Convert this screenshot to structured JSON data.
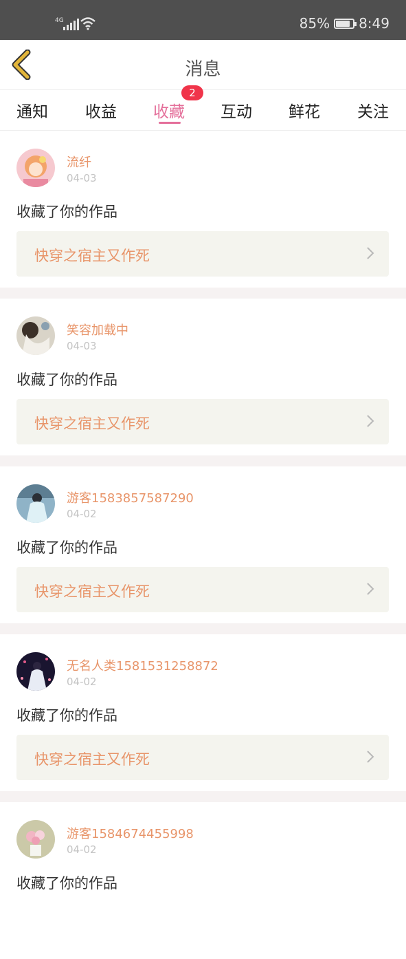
{
  "status_bar": {
    "network": "4G",
    "battery": "85%",
    "battery_level": 0.85,
    "time": "8:49"
  },
  "nav": {
    "title": "消息"
  },
  "tabs": [
    {
      "label": "通知"
    },
    {
      "label": "收益"
    },
    {
      "label": "收藏",
      "active": true,
      "badge": "2"
    },
    {
      "label": "互动"
    },
    {
      "label": "鲜花"
    },
    {
      "label": "关注"
    }
  ],
  "items": [
    {
      "username": "流纤",
      "date": "04-03",
      "action": "收藏了你的作品",
      "work_title": "快穿之宿主又作死"
    },
    {
      "username": "笑容加载中",
      "date": "04-03",
      "action": "收藏了你的作品",
      "work_title": "快穿之宿主又作死"
    },
    {
      "username": "游客1583857587290",
      "date": "04-02",
      "action": "收藏了你的作品",
      "work_title": "快穿之宿主又作死"
    },
    {
      "username": "无名人类1581531258872",
      "date": "04-02",
      "action": "收藏了你的作品",
      "work_title": "快穿之宿主又作死"
    },
    {
      "username": "游客1584674455998",
      "date": "04-02",
      "action": "收藏了你的作品"
    }
  ],
  "colors": {
    "accent": "#e46f9a",
    "name": "#e8956a",
    "badge": "#f0344a",
    "back_arrow": "#e2b53a"
  }
}
